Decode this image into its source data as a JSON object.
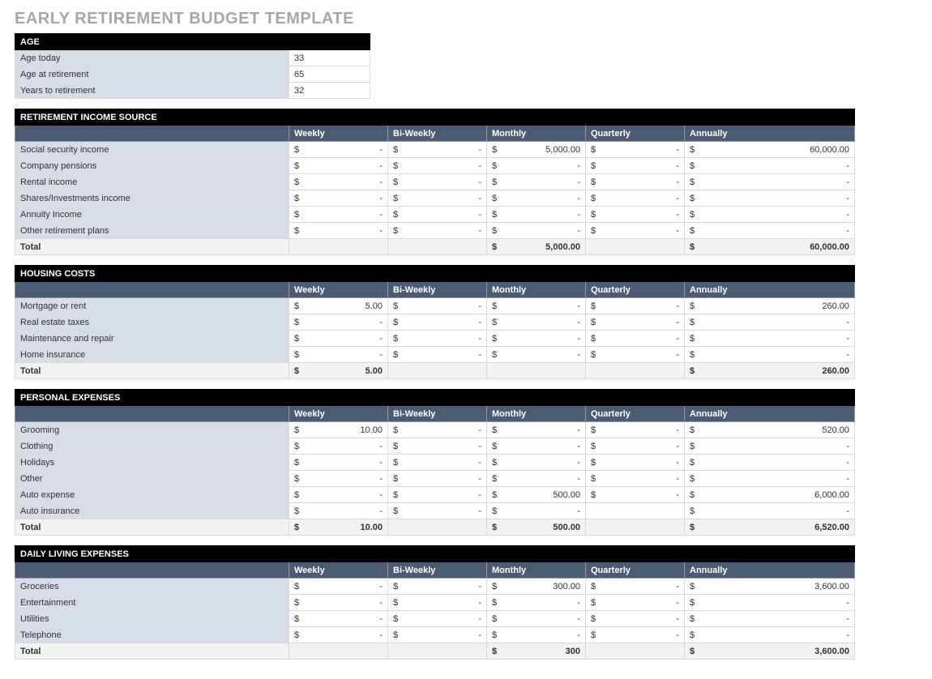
{
  "title": "EARLY RETIREMENT BUDGET TEMPLATE",
  "columns": {
    "weekly": "Weekly",
    "biweekly": "Bi-Weekly",
    "monthly": "Monthly",
    "quarterly": "Quarterly",
    "annually": "Annually"
  },
  "total_label": "Total",
  "age": {
    "header": "AGE",
    "rows": {
      "today": {
        "label": "Age today",
        "value": "33"
      },
      "retire": {
        "label": "Age at retirement",
        "value": "65"
      },
      "years": {
        "label": "Years to retirement",
        "value": "32"
      }
    }
  },
  "income": {
    "header": "RETIREMENT INCOME SOURCE",
    "rows": {
      "ss": {
        "label": "Social security income",
        "weekly": "-",
        "biweekly": "-",
        "monthly": "5,000.00",
        "quarterly": "-",
        "annually": "60,000.00"
      },
      "pension": {
        "label": "Company pensions",
        "weekly": "-",
        "biweekly": "-",
        "monthly": "-",
        "quarterly": "-",
        "annually": "-"
      },
      "rental": {
        "label": "Rental income",
        "weekly": "-",
        "biweekly": "-",
        "monthly": "-",
        "quarterly": "-",
        "annually": "-"
      },
      "shares": {
        "label": "Shares/Investments income",
        "weekly": "-",
        "biweekly": "-",
        "monthly": "-",
        "quarterly": "-",
        "annually": "-"
      },
      "annuity": {
        "label": "Annuity Income",
        "weekly": "-",
        "biweekly": "-",
        "monthly": "-",
        "quarterly": "-",
        "annually": "-"
      },
      "other": {
        "label": "Other retirement plans",
        "weekly": "-",
        "biweekly": "-",
        "monthly": "-",
        "quarterly": "-",
        "annually": "-"
      }
    },
    "total": {
      "weekly": "",
      "biweekly": "",
      "monthly": "5,000.00",
      "quarterly": "",
      "annually": "60,000.00"
    }
  },
  "housing": {
    "header": "HOUSING COSTS",
    "rows": {
      "mortgage": {
        "label": "Mortgage or rent",
        "weekly": "5.00",
        "biweekly": "-",
        "monthly": "-",
        "quarterly": "-",
        "annually": "260.00"
      },
      "tax": {
        "label": "Real estate taxes",
        "weekly": "-",
        "biweekly": "-",
        "monthly": "-",
        "quarterly": "-",
        "annually": "-"
      },
      "maint": {
        "label": "Maintenance and repair",
        "weekly": "-",
        "biweekly": "-",
        "monthly": "-",
        "quarterly": "-",
        "annually": "-"
      },
      "ins": {
        "label": "Home insurance",
        "weekly": "-",
        "biweekly": "-",
        "monthly": "-",
        "quarterly": "-",
        "annually": "-"
      }
    },
    "total": {
      "weekly": "5.00",
      "biweekly": "",
      "monthly": "",
      "quarterly": "",
      "annually": "260.00"
    }
  },
  "personal": {
    "header": "PERSONAL EXPENSES",
    "rows": {
      "groom": {
        "label": "Grooming",
        "weekly": "10.00",
        "biweekly": "-",
        "monthly": "-",
        "quarterly": "-",
        "annually": "520.00"
      },
      "cloth": {
        "label": "Clothing",
        "weekly": "-",
        "biweekly": "-",
        "monthly": "-",
        "quarterly": "-",
        "annually": "-"
      },
      "holiday": {
        "label": "Holidays",
        "weekly": "-",
        "biweekly": "-",
        "monthly": "-",
        "quarterly": "-",
        "annually": "-"
      },
      "other": {
        "label": "Other",
        "weekly": "-",
        "biweekly": "-",
        "monthly": "-",
        "quarterly": "-",
        "annually": "-"
      },
      "autoexp": {
        "label": "Auto expense",
        "weekly": "-",
        "biweekly": "-",
        "monthly": "500.00",
        "quarterly": "-",
        "annually": "6,000.00"
      },
      "autoins": {
        "label": "Auto insurance",
        "weekly": "-",
        "biweekly": "-",
        "monthly": "-",
        "quarterly": "",
        "annually": "-"
      }
    },
    "total": {
      "weekly": "10.00",
      "biweekly": "",
      "monthly": "500.00",
      "quarterly": "",
      "annually": "6,520.00"
    }
  },
  "daily": {
    "header": "DAILY LIVING EXPENSES",
    "rows": {
      "groc": {
        "label": "Groceries",
        "weekly": "-",
        "biweekly": "-",
        "monthly": "300.00",
        "quarterly": "-",
        "annually": "3,600.00"
      },
      "ent": {
        "label": "Entertainment",
        "weekly": "-",
        "biweekly": "-",
        "monthly": "-",
        "quarterly": "-",
        "annually": "-"
      },
      "util": {
        "label": "Utilities",
        "weekly": "-",
        "biweekly": "-",
        "monthly": "-",
        "quarterly": "-",
        "annually": "-"
      },
      "tel": {
        "label": "Telephone",
        "weekly": "-",
        "biweekly": "-",
        "monthly": "-",
        "quarterly": "-",
        "annually": "-"
      }
    },
    "total": {
      "weekly": "",
      "biweekly": "",
      "monthly": "300",
      "quarterly": "",
      "annually": "3,600.00"
    }
  }
}
